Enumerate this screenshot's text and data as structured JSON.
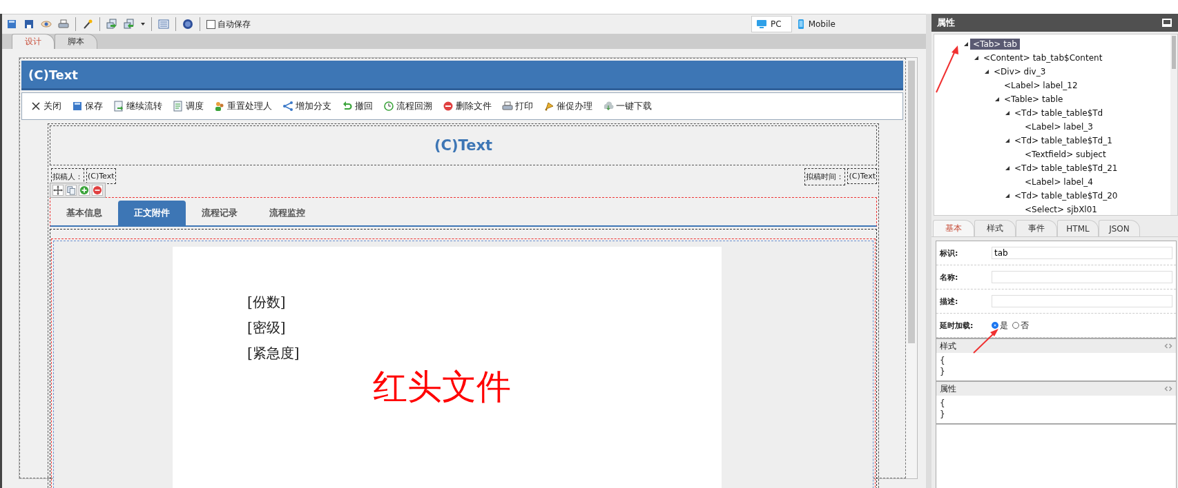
{
  "toolbar": {
    "autosave": {
      "label": "自动保存",
      "checked": false
    },
    "views": [
      {
        "label": "PC",
        "selected": true
      },
      {
        "label": "Mobile",
        "selected": false
      }
    ]
  },
  "design_tabs": [
    {
      "label": "设计",
      "selected": true
    },
    {
      "label": "脚本",
      "selected": false
    }
  ],
  "form": {
    "header": "(C)Text",
    "actions": [
      {
        "label": "关闭"
      },
      {
        "label": "保存"
      },
      {
        "label": "继续流转"
      },
      {
        "label": "调度"
      },
      {
        "label": "重置处理人"
      },
      {
        "label": "增加分支"
      },
      {
        "label": "撤回"
      },
      {
        "label": "流程回溯"
      },
      {
        "label": "删除文件"
      },
      {
        "label": "打印"
      },
      {
        "label": "催促办理"
      },
      {
        "label": "一键下载"
      }
    ],
    "title": "(C)Text",
    "drafter_label": "拟稿人：",
    "drafter_value": "(C)Text",
    "draft_time_label": "拟稿时间：",
    "draft_time_value": "(C)Text",
    "tabs": [
      {
        "label": "基本信息",
        "selected": false
      },
      {
        "label": "正文附件",
        "selected": true
      },
      {
        "label": "流程记录",
        "selected": false
      },
      {
        "label": "流程监控",
        "selected": false
      }
    ],
    "document": {
      "fields": [
        "[份数]",
        "[密级]",
        "[紧急度]"
      ],
      "heading": "红头文件"
    }
  },
  "panel": {
    "title": "属性",
    "tree": [
      {
        "label": "<Tab> tab",
        "selected": true,
        "expanded": true,
        "children": [
          {
            "label": "<Content> tab_tab$Content",
            "selected": false,
            "expanded": true,
            "children": [
              {
                "label": "<Div> div_3",
                "selected": false,
                "expanded": true,
                "children": [
                  {
                    "label": "<Label> label_12",
                    "selected": false
                  },
                  {
                    "label": "<Table> table",
                    "selected": false,
                    "expanded": true,
                    "children": [
                      {
                        "label": "<Td> table_table$Td",
                        "selected": false,
                        "expanded": true,
                        "children": [
                          {
                            "label": "<Label> label_3",
                            "selected": false
                          }
                        ]
                      },
                      {
                        "label": "<Td> table_table$Td_1",
                        "selected": false,
                        "expanded": true,
                        "children": [
                          {
                            "label": "<Textfield> subject",
                            "selected": false
                          }
                        ]
                      },
                      {
                        "label": "<Td> table_table$Td_21",
                        "selected": false,
                        "expanded": true,
                        "children": [
                          {
                            "label": "<Label> label_4",
                            "selected": false
                          }
                        ]
                      },
                      {
                        "label": "<Td> table_table$Td_20",
                        "selected": false,
                        "expanded": true,
                        "children": [
                          {
                            "label": "<Select> sjbXl01",
                            "selected": false
                          }
                        ]
                      }
                    ]
                  }
                ]
              }
            ]
          }
        ]
      }
    ],
    "tabs": [
      {
        "label": "基本",
        "selected": true
      },
      {
        "label": "样式",
        "selected": false
      },
      {
        "label": "事件",
        "selected": false
      },
      {
        "label": "HTML",
        "selected": false
      },
      {
        "label": "JSON",
        "selected": false
      }
    ],
    "fields": [
      {
        "label": "标识:",
        "value": "tab"
      },
      {
        "label": "名称:"
      },
      {
        "label": "描述:"
      }
    ],
    "lazy_load": {
      "label": "延时加载:",
      "options": [
        {
          "label": "是",
          "selected": true
        },
        {
          "label": "否",
          "selected": false
        }
      ]
    },
    "sections": [
      {
        "title": "样式",
        "lines": [
          "{",
          "}"
        ]
      },
      {
        "title": "属性",
        "lines": [
          "{",
          "}"
        ]
      }
    ]
  }
}
